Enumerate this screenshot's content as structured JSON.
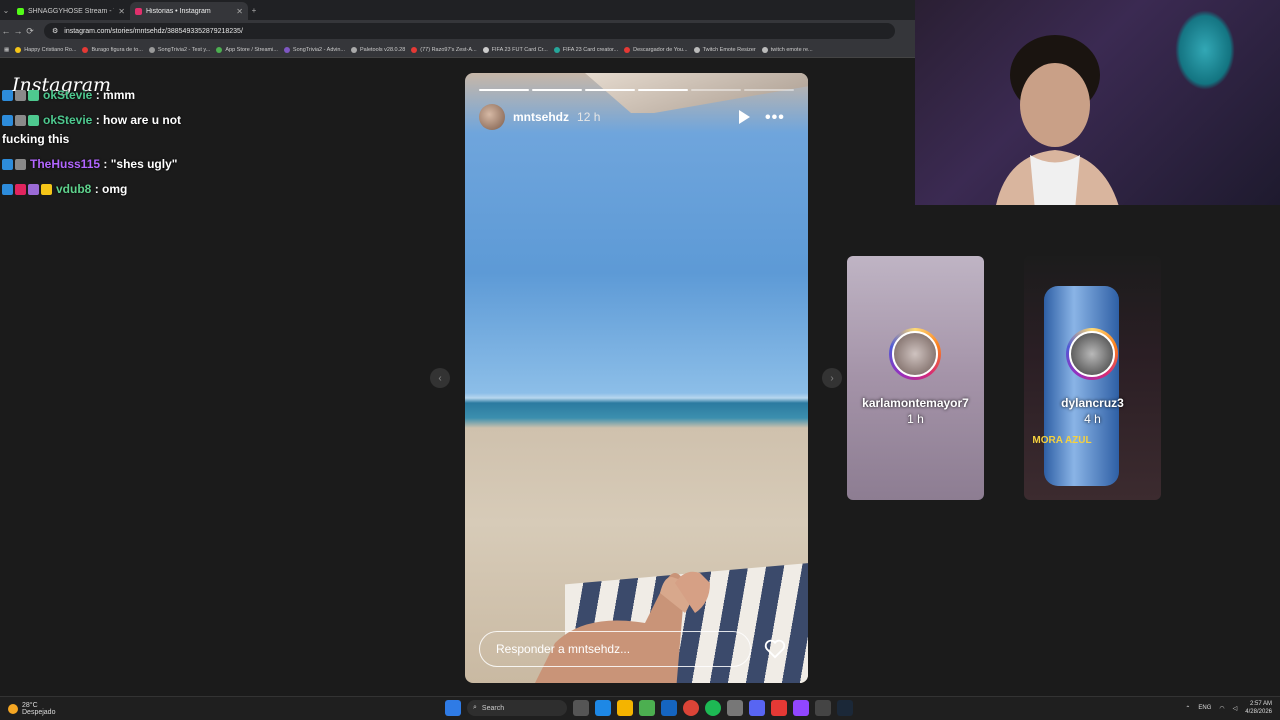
{
  "browser": {
    "tabs": [
      {
        "title": "SHNAGGYHOSE Stream - Watc",
        "favicon_color": "#53fc18",
        "active": false
      },
      {
        "title": "Historias • Instagram",
        "favicon_color": "#e1306c",
        "active": true
      }
    ],
    "new_tab": "+",
    "url": "instagram.com/stories/mntsehdz/3885493352879218235/",
    "bookmarks": [
      "Happy Cristiano Ro...",
      "Burago figura de to...",
      "SongTrivia2 - Test y...",
      "App Store / Streami...",
      "SongTrivia2 - Advin...",
      "Paletools v28.0.28",
      "(77) Razo97's Zest-A...",
      "FIFA 23 FUT Card Cr...",
      "FIFA 23 Card creator...",
      "Descargador de You...",
      "Twitch Emote Resizer",
      "twitch emote re..."
    ]
  },
  "instagram": {
    "logo": "Instagram"
  },
  "chat": [
    {
      "user": "okStevie",
      "user_color": "#4ec98f",
      "text": ": mmm",
      "badges": [
        "#2d8cdb",
        "#8a8a8a",
        "#4ec98f"
      ]
    },
    {
      "user": "okStevie",
      "user_color": "#4ec98f",
      "text": ": how are u not fucking this",
      "badges": [
        "#2d8cdb",
        "#8a8a8a",
        "#4ec98f"
      ]
    },
    {
      "user": "TheHuss115",
      "user_color": "#b266ff",
      "text": ": \"shes ugly\"",
      "badges": [
        "#2d8cdb",
        "#8a8a8a"
      ]
    },
    {
      "user": "vdub8",
      "user_color": "#5fd38d",
      "text": ": omg",
      "badges": [
        "#2d8cdb",
        "#e0245e",
        "#9b6bd6",
        "#f5c518"
      ]
    }
  ],
  "story": {
    "username": "mntsehdz",
    "time": "12 h",
    "reply_placeholder": "Responder a mntsehdz...",
    "progress_total": 6,
    "progress_done": 4,
    "icons": {
      "play": "play-icon",
      "more": "more-icon",
      "like": "heart-icon"
    }
  },
  "previews": [
    {
      "username": "karlamontemayor7",
      "time": "1 h"
    },
    {
      "username": "dylancruz3",
      "time": "4 h",
      "can_label": "MORA AZUL"
    }
  ],
  "taskbar": {
    "weather_temp": "28°C",
    "weather_desc": "Despejado",
    "search_label": "Search",
    "language": "ENG",
    "time": "2:57 AM",
    "date": "4/28/2026"
  }
}
